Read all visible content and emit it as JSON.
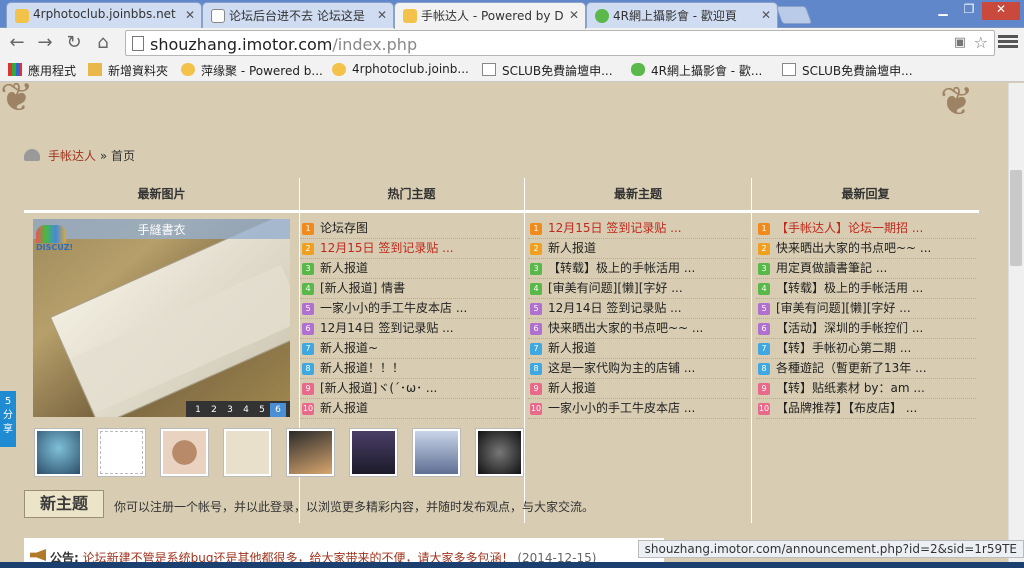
{
  "browser": {
    "tabs": [
      {
        "label": "4rphotoclub.joinbbs.net",
        "active": false,
        "icon": "sunflower-icon"
      },
      {
        "label": "论坛后台进不去 论坛这是",
        "active": false,
        "icon": "page-icon"
      },
      {
        "label": "手帐达人 - Powered by D",
        "active": true,
        "icon": "sunflower-icon"
      },
      {
        "label": "4R網上攝影會 - 歡迎頁",
        "active": false,
        "icon": "chat-icon"
      }
    ],
    "url_host": "shouzhang.imotor.com",
    "url_path": "/index.php",
    "bookmarks": [
      {
        "label": "應用程式"
      },
      {
        "label": "新增資料夾"
      },
      {
        "label": "萍缘聚 - Powered b..."
      },
      {
        "label": "4rphotoclub.joinb..."
      },
      {
        "label": "SCLUB免費論壇申..."
      },
      {
        "label": "4R網上攝影會 - 歡..."
      },
      {
        "label": "SCLUB免費論壇申..."
      }
    ],
    "status_url": "shouzhang.imotor.com/announcement.php?id=2&sid=1r59TE"
  },
  "breadcrumb": {
    "site": "手帐达人",
    "sep": "»",
    "current": "首页"
  },
  "portal": {
    "headers": [
      "最新图片",
      "热门主题",
      "最新主题",
      "最新回复"
    ],
    "slideshow": {
      "title": "手縫書衣",
      "logo": "DISCUZ!",
      "pages": [
        "1",
        "2",
        "3",
        "4",
        "5",
        "6"
      ],
      "active_page": "6"
    },
    "hot": [
      {
        "n": "1",
        "t": "论坛存图",
        "red": false
      },
      {
        "n": "2",
        "t": "12月15日 签到记录贴 ...",
        "red": true
      },
      {
        "n": "3",
        "t": "新人报道",
        "red": false
      },
      {
        "n": "4",
        "t": "[新人报道] 情書",
        "red": false
      },
      {
        "n": "5",
        "t": "一家小小的手工牛皮本店 ...",
        "red": false
      },
      {
        "n": "6",
        "t": "12月14日 签到记录贴 ...",
        "red": false
      },
      {
        "n": "7",
        "t": "新人报道~",
        "red": false
      },
      {
        "n": "8",
        "t": "新人报道！！！",
        "red": false
      },
      {
        "n": "9",
        "t": "[新人报道]ヾ(´･ω･ ...",
        "red": false
      },
      {
        "n": "10",
        "t": "新人报道",
        "red": false
      }
    ],
    "latest": [
      {
        "n": "1",
        "t": "12月15日 签到记录贴 ...",
        "red": true
      },
      {
        "n": "2",
        "t": "新人报道",
        "red": false
      },
      {
        "n": "3",
        "t": "【转载】极上的手帐活用 ...",
        "red": false
      },
      {
        "n": "4",
        "t": "[审美有问题][懒][字好 ...",
        "red": false
      },
      {
        "n": "5",
        "t": "12月14日 签到记录贴 ...",
        "red": false
      },
      {
        "n": "6",
        "t": "快来晒出大家的书点吧~~ ...",
        "red": false
      },
      {
        "n": "7",
        "t": "新人报道",
        "red": false
      },
      {
        "n": "8",
        "t": "这是一家代购为主的店铺 ...",
        "red": false
      },
      {
        "n": "9",
        "t": "新人报道",
        "red": false
      },
      {
        "n": "10",
        "t": "一家小小的手工牛皮本店 ...",
        "red": false
      }
    ],
    "replies": [
      {
        "n": "1",
        "t": "【手帐达人】论坛一期招 ...",
        "red": true
      },
      {
        "n": "2",
        "t": "快来晒出大家的书点吧~~ ...",
        "red": false
      },
      {
        "n": "3",
        "t": "用定頁做讀書筆記 ...",
        "red": false
      },
      {
        "n": "4",
        "t": "【转载】极上的手帐活用 ...",
        "red": false
      },
      {
        "n": "5",
        "t": "[审美有问题][懒][字好 ...",
        "red": false
      },
      {
        "n": "6",
        "t": "【活动】深圳的手帐控们 ...",
        "red": false
      },
      {
        "n": "7",
        "t": "【转】手帐初心第二期 ...",
        "red": false
      },
      {
        "n": "8",
        "t": "各種遊記（暫更新了13年 ...",
        "red": false
      },
      {
        "n": "9",
        "t": "【转】贴纸素材 by：am ...",
        "red": false
      },
      {
        "n": "10",
        "t": "【品牌推荐】【布皮店】 ...",
        "red": false
      }
    ]
  },
  "new_topic_label": "新主题",
  "register_text": "你可以注册一个帐号，并以此登录，以浏览更多精彩内容，并随时发布观点，与大家交流。",
  "announcement": {
    "label": "公告:",
    "text": "论坛新建不管是系统bug还是其他都很多，给大家带来的不便，请大家多多包涵！",
    "date": "(2014-12-15)"
  },
  "share_label": "分享",
  "share_num": "5",
  "colors": {
    "red": "#c0281c",
    "link": "#a0341e",
    "bg": "#d8cdb2",
    "n1": "#f08a1c",
    "n2": "#f0a020",
    "n3": "#58b848",
    "n4": "#58b848",
    "n5": "#b070d0",
    "n6": "#b070d0",
    "n7": "#3fa8e0",
    "n8": "#3fa8e0",
    "n9": "#e86a8a",
    "n10": "#e86a8a"
  }
}
